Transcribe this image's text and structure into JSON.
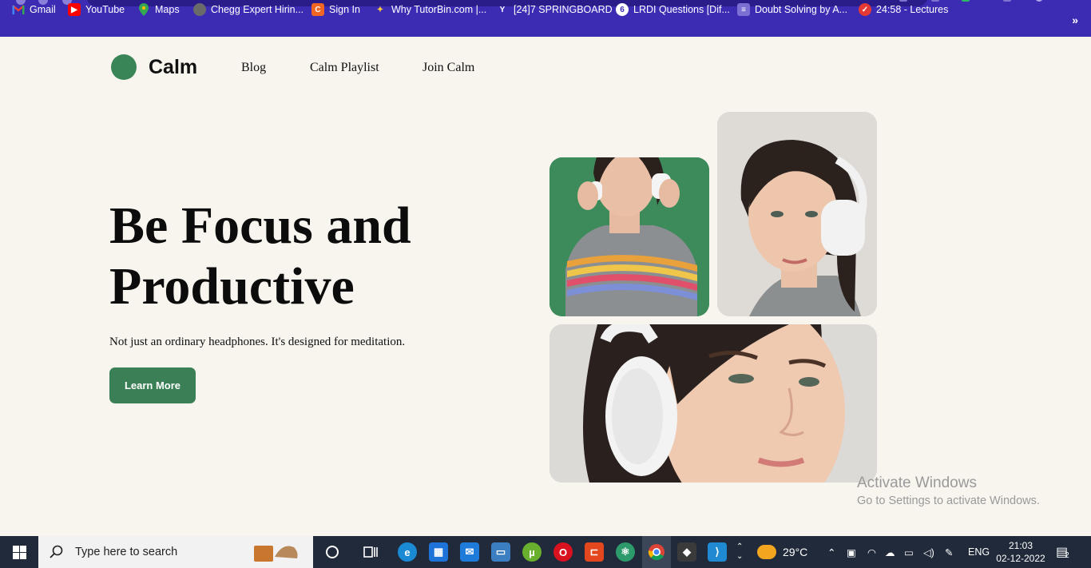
{
  "browser": {
    "bookmarks": [
      {
        "label": "Gmail",
        "icon": "gmail-icon"
      },
      {
        "label": "YouTube",
        "icon": "youtube-icon"
      },
      {
        "label": "Maps",
        "icon": "maps-icon"
      },
      {
        "label": "Chegg Expert Hirin...",
        "icon": "chegg-icon"
      },
      {
        "label": "Sign In",
        "icon": "signin-icon"
      },
      {
        "label": "Why TutorBin.com |...",
        "icon": "tutorbin-icon"
      },
      {
        "label": "[24]7 SPRINGBOARD",
        "icon": "springboard-icon"
      },
      {
        "label": "LRDI Questions [Dif...",
        "icon": "lrdi-icon"
      },
      {
        "label": "Doubt Solving by A...",
        "icon": "doubt-solving-icon"
      },
      {
        "label": "24:58 - Lectures",
        "icon": "lectures-icon"
      }
    ],
    "more": "»"
  },
  "site": {
    "logo": "Calm",
    "nav": [
      {
        "label": "Blog"
      },
      {
        "label": "Calm Playlist"
      },
      {
        "label": "Join Calm"
      }
    ],
    "hero": {
      "title_line1": "Be Focus and",
      "title_line2": "Productive",
      "subtitle": "Not just an ordinary headphones. It's designed for meditation.",
      "cta": "Learn More"
    },
    "colors": {
      "accent": "#3a7f55",
      "background": "#f8f4ee"
    }
  },
  "watermark": {
    "line1": "Activate Windows",
    "line2": "Go to Settings to activate Windows."
  },
  "taskbar": {
    "search_placeholder": "Type here to search",
    "weather": "29°C",
    "language": "ENG",
    "time": "21:03",
    "date": "02-12-2022",
    "notifications": "2"
  }
}
